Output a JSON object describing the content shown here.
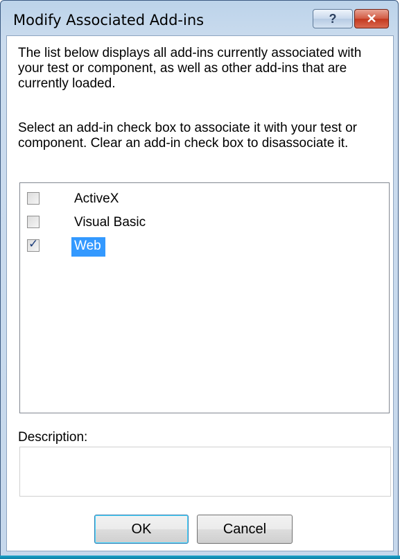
{
  "dialog": {
    "title": "Modify Associated Add-ins",
    "help_label": "?",
    "close_label": "✕",
    "intro_text": "The list below displays all add-ins currently associated with your test or component, as well as other add-ins that are currently loaded.",
    "instructions_text": "Select an add-in check box to associate it with your test or component. Clear an add-in check box to disassociate it.",
    "addins": [
      {
        "label": "ActiveX",
        "checked": false,
        "selected": false
      },
      {
        "label": "Visual Basic",
        "checked": false,
        "selected": false
      },
      {
        "label": "Web",
        "checked": true,
        "selected": true
      }
    ],
    "description_label": "Description:",
    "description_value": "",
    "ok_label": "OK",
    "cancel_label": "Cancel"
  },
  "colors": {
    "selection": "#3399ff",
    "close_button": "#c3391f",
    "title_bar": "#bcd3ea"
  }
}
